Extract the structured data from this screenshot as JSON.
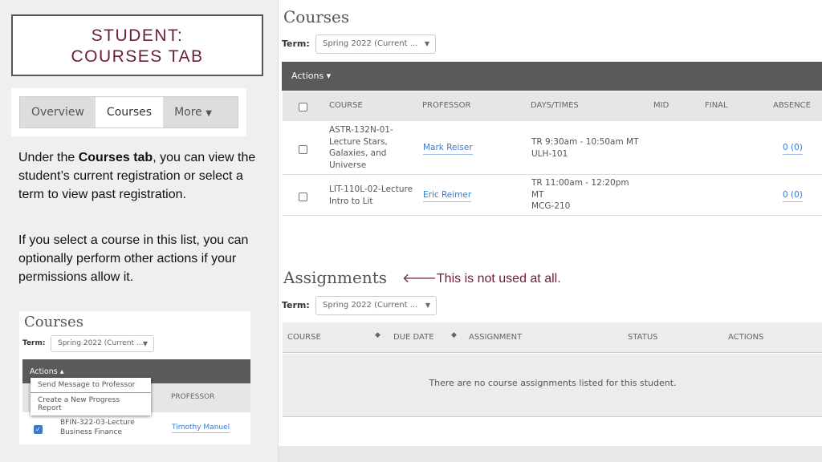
{
  "slide": {
    "title_line1": "STUDENT:",
    "title_line2": "COURSES TAB",
    "tabs": [
      "Overview",
      "Courses",
      "More"
    ],
    "para1_pre": "Under the ",
    "para1_bold": "Courses tab",
    "para1_post": ", you can view the student’s current registration or select a term to view past registration.",
    "para2": "If you select a course in this list, you can optionally perform other actions if your permissions allow it.",
    "note": "This is not used at all.",
    "note_arrow": "🡐"
  },
  "mini": {
    "title": "Courses",
    "term_label": "Term:",
    "term_value": "Spring 2022 (Current ...",
    "actions": "Actions ▴",
    "menu": [
      "Send Message to Professor",
      "Create a New Progress Report"
    ],
    "header_professor": "PROFESSOR",
    "row": {
      "course_line1": "BFIN-322-03-Lecture",
      "course_line2": "Business Finance",
      "professor": "Timothy Manuel",
      "checked": true
    }
  },
  "courses": {
    "title": "Courses",
    "term_label": "Term:",
    "term_value": "Spring 2022 (Current ...",
    "actions": "Actions ▾",
    "columns": [
      "COURSE",
      "PROFESSOR",
      "DAYS/TIMES",
      "MID",
      "FINAL",
      "ABSENCE"
    ],
    "rows": [
      {
        "course": [
          "ASTR-132N-01-",
          "Lecture Stars,",
          "Galaxies, and",
          "Universe"
        ],
        "professor": "Mark Reiser",
        "times": [
          "TR 9:30am - 10:50am MT",
          "ULH-101"
        ],
        "mid": "",
        "final": "",
        "absence": "0 (0)"
      },
      {
        "course": [
          "LIT-110L-02-Lecture",
          "Intro to Lit"
        ],
        "professor": "Eric Reimer",
        "times": [
          "TR 11:00am - 12:20pm",
          "MT",
          "MCG-210"
        ],
        "mid": "",
        "final": "",
        "absence": "0 (0)"
      }
    ]
  },
  "assignments": {
    "title": "Assignments",
    "term_label": "Term:",
    "term_value": "Spring 2022 (Current ...",
    "columns": [
      "COURSE",
      "DUE DATE",
      "ASSIGNMENT",
      "STATUS",
      "ACTIONS"
    ],
    "empty": "There are no course assignments listed for this student."
  },
  "colors": {
    "accent": "#6b1d3a",
    "link": "#3a7bc8",
    "action_bar": "#5a5a5a"
  }
}
